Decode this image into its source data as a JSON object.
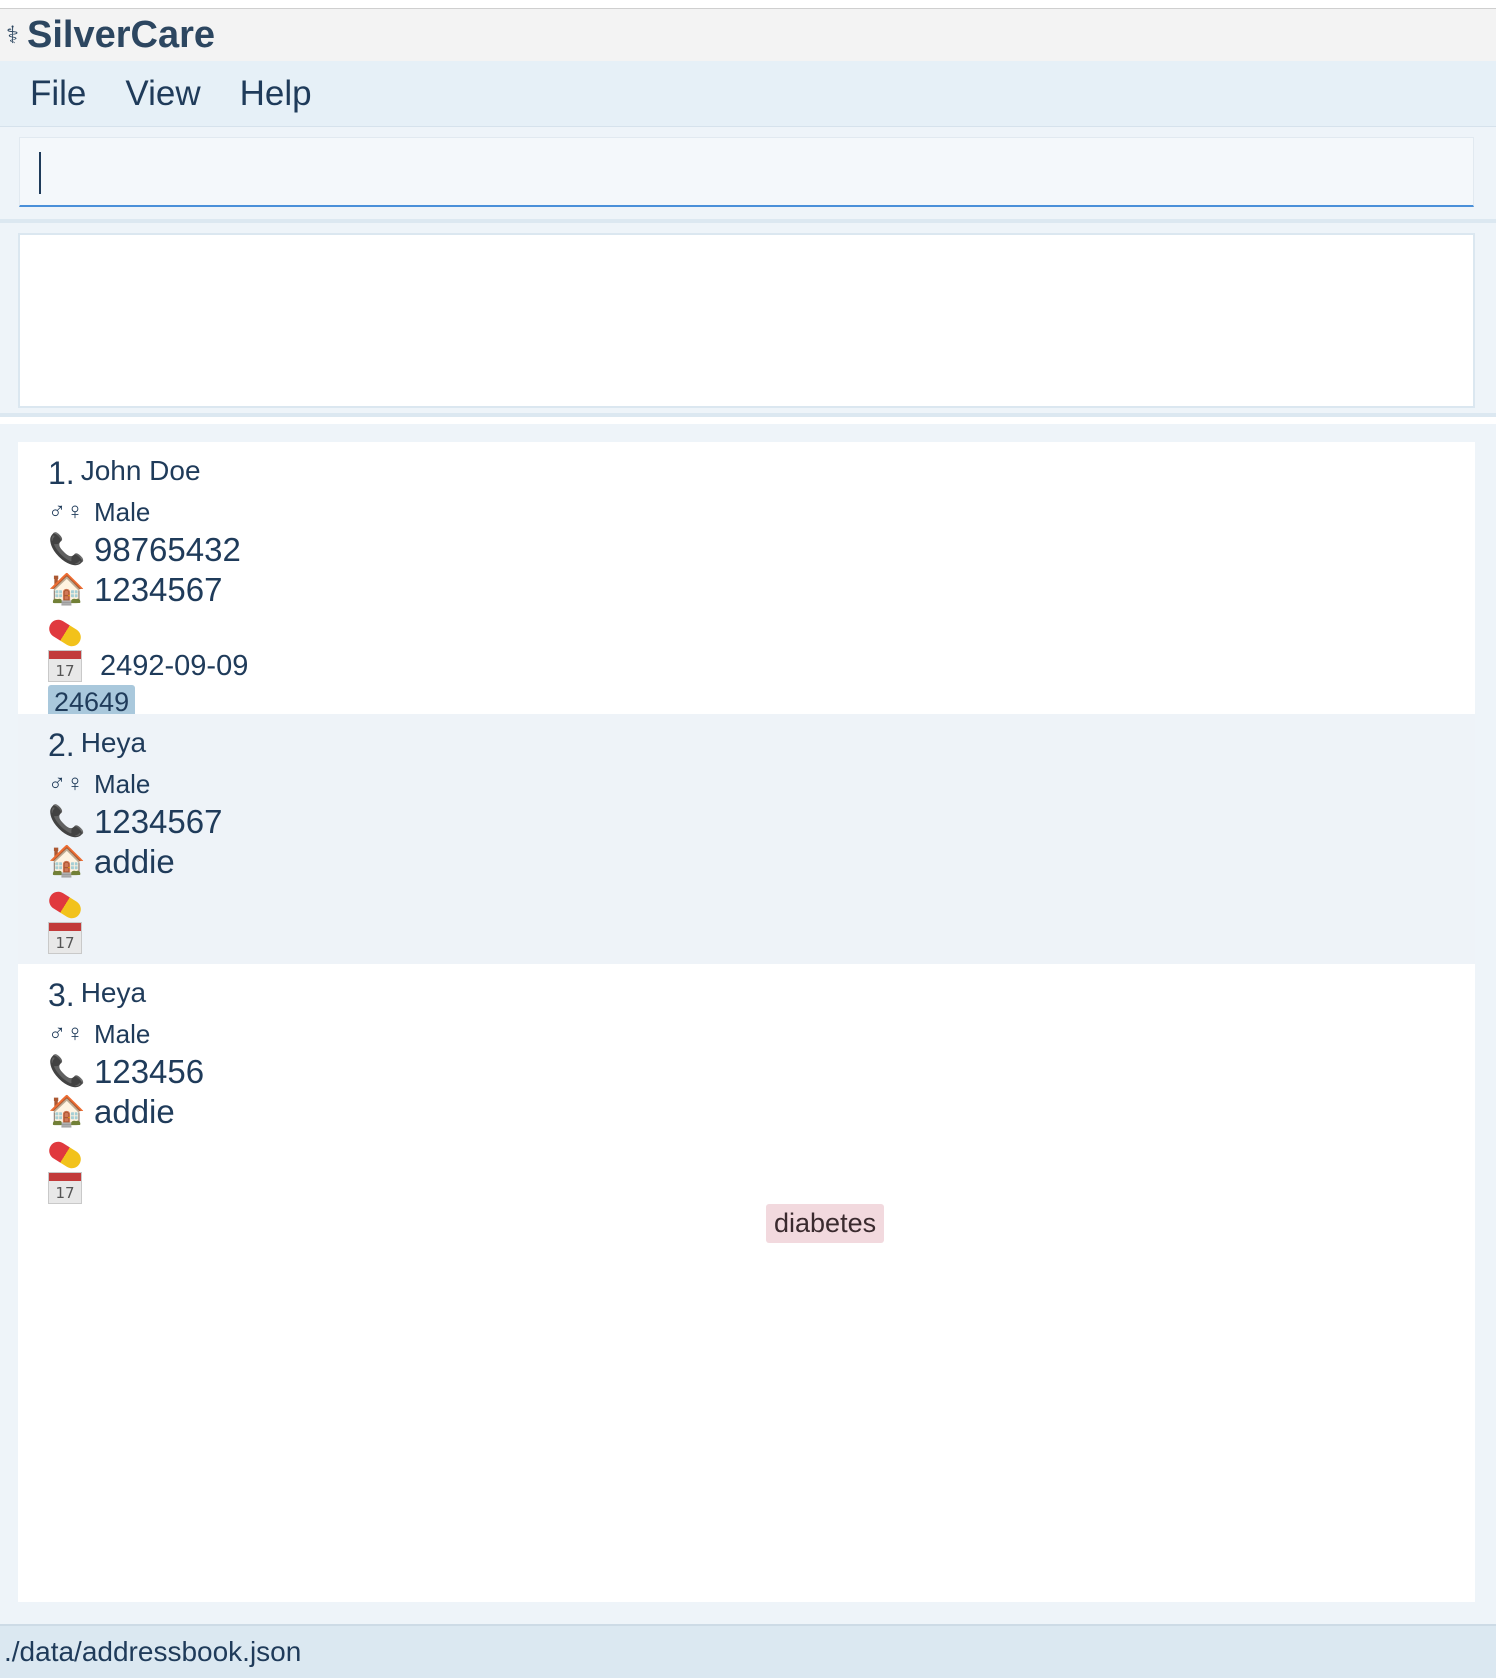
{
  "app": {
    "title": "SilverCare",
    "icon": "caduceus-icon"
  },
  "menu": {
    "items": [
      {
        "label": "File"
      },
      {
        "label": "View"
      },
      {
        "label": "Help"
      }
    ]
  },
  "command": {
    "value": "",
    "placeholder": ""
  },
  "result": {
    "text": ""
  },
  "persons": [
    {
      "index": "1.",
      "name": "John Doe",
      "gender_icon": "♂♀",
      "gender": "Male",
      "phone": "98765432",
      "address": "1234567",
      "medication": "",
      "date": "2492-09-09",
      "tag": "24649"
    },
    {
      "index": "2.",
      "name": "Heya",
      "gender_icon": "♂♀",
      "gender": "Male",
      "phone": "1234567",
      "address": "addie",
      "medication": "",
      "date": ""
    },
    {
      "index": "3.",
      "name": "Heya",
      "gender_icon": "♂♀",
      "gender": "Male",
      "phone": "123456",
      "address": "addie",
      "medication": "",
      "date": "",
      "tag": "diabetes"
    }
  ],
  "icons": {
    "phone": "📞",
    "home": "🏠",
    "pill": "pill-icon",
    "calendar_day": "17"
  },
  "status": {
    "path": "./data/addressbook.json"
  }
}
